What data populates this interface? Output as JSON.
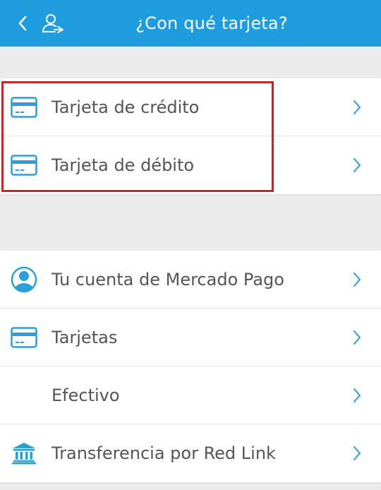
{
  "header": {
    "title": "¿Con qué tarjeta?"
  },
  "colors": {
    "topbar": "#1e9ce0",
    "accent": "#2a9fd8",
    "highlight_border": "#e21b23",
    "text": "#555555",
    "background": "#ececec"
  },
  "card_types": {
    "items": [
      {
        "label": "Tarjeta de crédito",
        "icon": "credit-card-icon"
      },
      {
        "label": "Tarjeta de débito",
        "icon": "credit-card-icon"
      }
    ]
  },
  "payment_methods": {
    "items": [
      {
        "label": "Tu cuenta de Mercado Pago",
        "icon": "account-user-icon"
      },
      {
        "label": "Tarjetas",
        "icon": "credit-card-icon"
      },
      {
        "label": "Efectivo",
        "icon": ""
      },
      {
        "label": "Transferencia por Red Link",
        "icon": "bank-icon"
      }
    ]
  }
}
